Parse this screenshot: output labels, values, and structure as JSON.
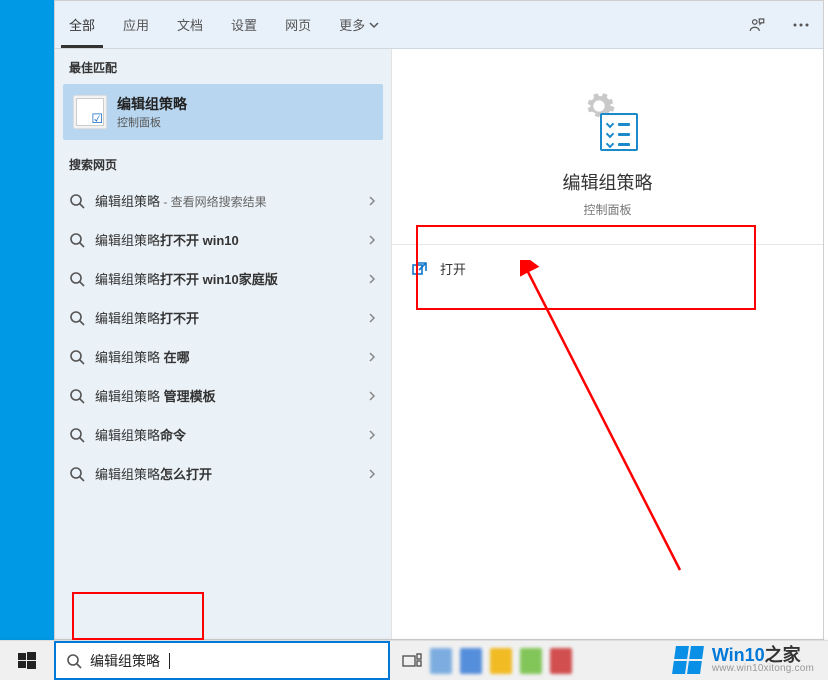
{
  "tabs": {
    "all": "全部",
    "apps": "应用",
    "docs": "文档",
    "settings": "设置",
    "web": "网页",
    "more": "更多"
  },
  "sections": {
    "best_match": "最佳匹配",
    "web_search": "搜索网页"
  },
  "best_match": {
    "title": "编辑组策略",
    "subtitle": "控制面板"
  },
  "web_results": [
    {
      "query": "编辑组策略",
      "bold_suffix": "",
      "extra": " - 查看网络搜索结果"
    },
    {
      "query": "编辑组策略",
      "bold_suffix": "打不开 win10",
      "extra": ""
    },
    {
      "query": "编辑组策略",
      "bold_suffix": "打不开 win10家庭版",
      "extra": ""
    },
    {
      "query": "编辑组策略",
      "bold_suffix": "打不开",
      "extra": ""
    },
    {
      "query": "编辑组策略",
      "bold_suffix": " 在哪",
      "extra": ""
    },
    {
      "query": "编辑组策略",
      "bold_suffix": " 管理模板",
      "extra": ""
    },
    {
      "query": "编辑组策略",
      "bold_suffix": "命令",
      "extra": ""
    },
    {
      "query": "编辑组策略",
      "bold_suffix": "怎么打开",
      "extra": ""
    }
  ],
  "preview": {
    "title": "编辑组策略",
    "subtitle": "控制面板",
    "open_label": "打开"
  },
  "search": {
    "value": "编辑组策略"
  },
  "watermark": {
    "brand_prefix": "Win10",
    "brand_suffix": "之家",
    "url": "www.win10xitong.com"
  }
}
